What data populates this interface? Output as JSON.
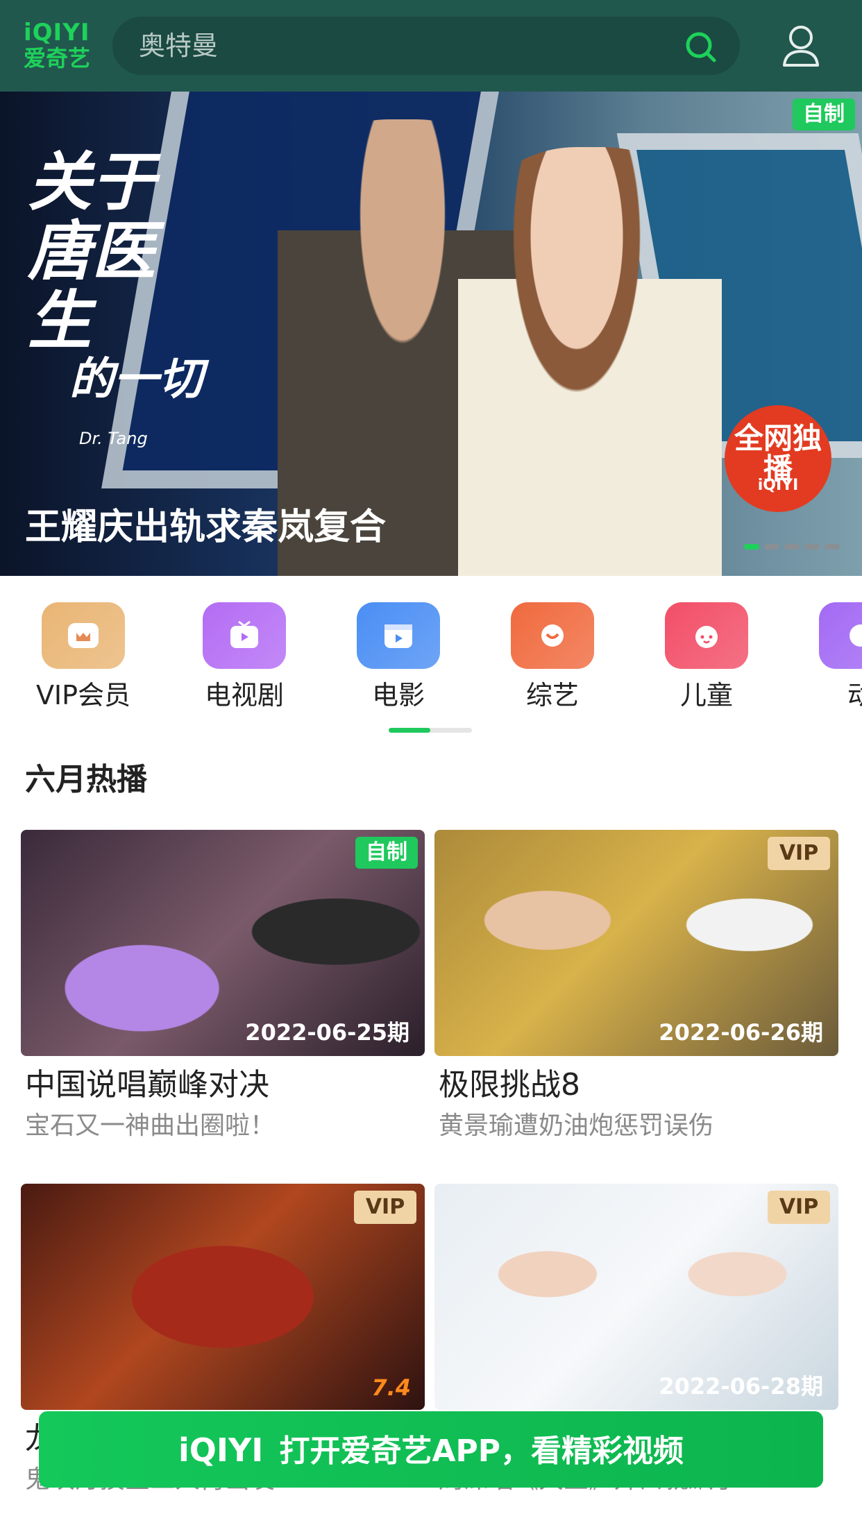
{
  "header": {
    "logo_top": "iQIYI",
    "logo_bottom": "爱奇艺",
    "search_placeholder": "奥特曼",
    "search_icon": "search-icon",
    "user_icon": "user-icon",
    "brand_color": "#1ed15a"
  },
  "banner": {
    "title_art_main": "关于唐医生",
    "title_art_sub": "的一切",
    "title_art_en": "Dr. Tang",
    "badge": "自制",
    "stamp_main": "全网独播",
    "stamp_brand": "iQIYI",
    "caption": "王耀庆出轨求秦岚复合",
    "page_count": 5,
    "active_page": 1
  },
  "categories": [
    {
      "label": "VIP会员",
      "icon": "vip-crown-icon",
      "color": "#e9b574"
    },
    {
      "label": "电视剧",
      "icon": "tv-icon",
      "color": "#b46cf4"
    },
    {
      "label": "电影",
      "icon": "movie-clapper-icon",
      "color": "#4a8ef4"
    },
    {
      "label": "综艺",
      "icon": "variety-icon",
      "color": "#f06a3e"
    },
    {
      "label": "儿童",
      "icon": "kids-face-icon",
      "color": "#f24e67"
    },
    {
      "label": "动",
      "icon": "anime-icon",
      "color": "#a36af4"
    }
  ],
  "category_scroll_progress": 0.5,
  "section": {
    "title": "六月热播"
  },
  "cards": [
    {
      "badge": "自制",
      "badge_type": "zizhi",
      "overlay": "2022-06-25期",
      "overlay_type": "date",
      "title": "中国说唱巅峰对决",
      "subtitle": "宝石又一神曲出圈啦！"
    },
    {
      "badge": "VIP",
      "badge_type": "vip",
      "overlay": "2022-06-26期",
      "overlay_type": "date",
      "title": "极限挑战8",
      "subtitle": "黄景瑜遭奶油炮惩罚误伤"
    },
    {
      "badge": "VIP",
      "badge_type": "vip",
      "overlay": "7.4",
      "overlay_type": "score",
      "title": "龙",
      "subtitle": "鬼吹灯摸金三人再出发"
    },
    {
      "badge": "VIP",
      "badge_type": "vip",
      "overlay": "2022-06-28期",
      "overlay_type": "date",
      "title": "",
      "subtitle": "周深唱《大鱼》开口就飙了"
    }
  ],
  "open_app": {
    "brand": "iQIYI",
    "text": "打开爱奇艺APP，看精彩视频"
  }
}
